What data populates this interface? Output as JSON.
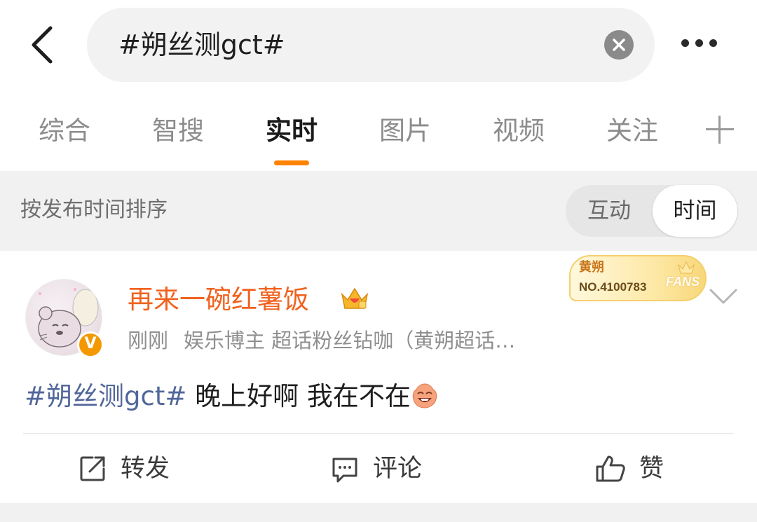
{
  "search": {
    "query": "#朔丝测gct#"
  },
  "tabs": [
    {
      "label": "综合",
      "active": false
    },
    {
      "label": "智搜",
      "active": false
    },
    {
      "label": "实时",
      "active": true
    },
    {
      "label": "图片",
      "active": false
    },
    {
      "label": "视频",
      "active": false
    },
    {
      "label": "关注",
      "active": false
    }
  ],
  "sort": {
    "label": "按发布时间排序",
    "options": [
      "互动",
      "时间"
    ],
    "selected": "时间"
  },
  "post": {
    "username": "再来一碗红薯饭",
    "time": "刚刚",
    "description": "娱乐博主 超话粉丝钻咖（黄朔超话…",
    "verified_badge": "V",
    "fans_badge": {
      "name": "黄朔",
      "number": "NO.4100783",
      "word": "FANS"
    },
    "content": {
      "hashtag": "#朔丝测gct#",
      "text": "晚上好啊 我在不在"
    },
    "actions": {
      "repost": "转发",
      "comment": "评论",
      "like": "赞"
    }
  },
  "colors": {
    "accent": "#ff8200",
    "username": "#f0621e",
    "hashtag": "#51679a"
  }
}
